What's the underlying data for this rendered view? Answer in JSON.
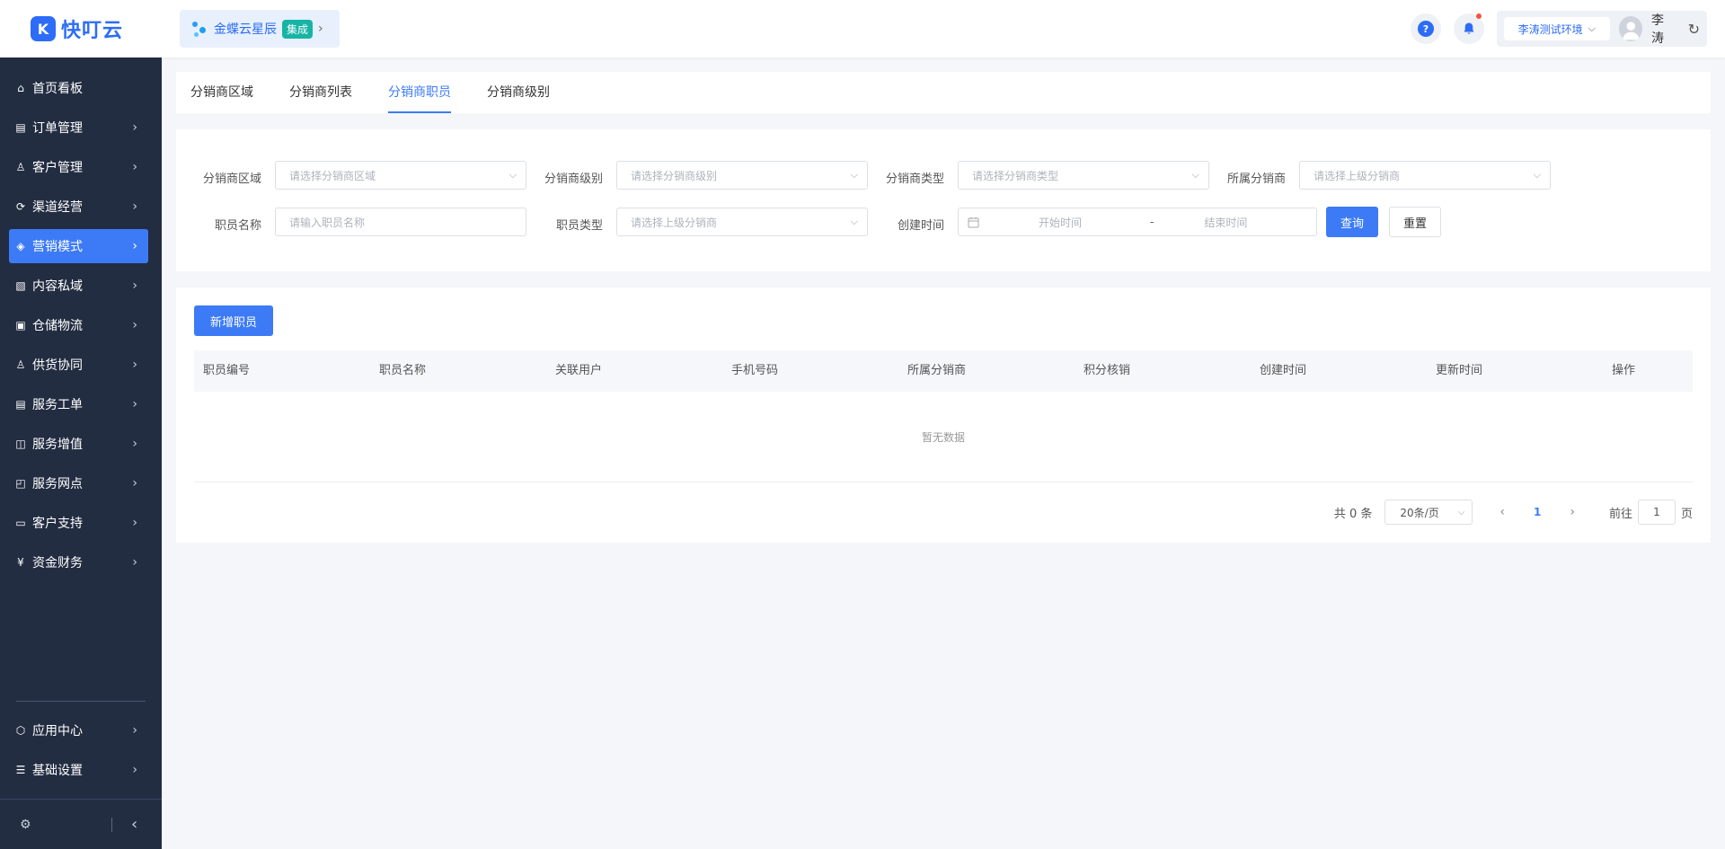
{
  "brand": {
    "logo_glyph": "K",
    "name": "快叮云"
  },
  "integration": {
    "name": "金蝶云星辰",
    "badge": "集成",
    "chevron": "›"
  },
  "header": {
    "help_glyph": "?",
    "env_label": "李涛测试环境",
    "user_name": "李涛",
    "refresh_glyph": "↻"
  },
  "sidebar": {
    "items": [
      {
        "label": "首页看板",
        "icon": "home-icon",
        "glyph": "⌂"
      },
      {
        "label": "订单管理",
        "icon": "clipboard-icon",
        "glyph": "▤"
      },
      {
        "label": "客户管理",
        "icon": "user-icon",
        "glyph": "♙"
      },
      {
        "label": "渠道经营",
        "icon": "channel-icon",
        "glyph": "⟳"
      },
      {
        "label": "营销模式",
        "icon": "tag-icon",
        "glyph": "◈"
      },
      {
        "label": "内容私域",
        "icon": "image-icon",
        "glyph": "▧"
      },
      {
        "label": "仓储物流",
        "icon": "box-icon",
        "glyph": "▣"
      },
      {
        "label": "供货协同",
        "icon": "supplier-icon",
        "glyph": "♙"
      },
      {
        "label": "服务工单",
        "icon": "ticket-icon",
        "glyph": "▤"
      },
      {
        "label": "服务增值",
        "icon": "bag-icon",
        "glyph": "◫"
      },
      {
        "label": "服务网点",
        "icon": "store-icon",
        "glyph": "◰"
      },
      {
        "label": "客户支持",
        "icon": "support-icon",
        "glyph": "▭"
      },
      {
        "label": "资金财务",
        "icon": "yen-icon",
        "glyph": "¥"
      }
    ],
    "bottom_items": [
      {
        "label": "应用中心",
        "icon": "cube-icon",
        "glyph": "⬡"
      },
      {
        "label": "基础设置",
        "icon": "settings-sliders-icon",
        "glyph": "☰"
      }
    ],
    "footer_settings_glyph": "⚙",
    "footer_collapse_glyph": "‹",
    "chevron": "›"
  },
  "tabs": [
    {
      "label": "分销商区域"
    },
    {
      "label": "分销商列表"
    },
    {
      "label": "分销商职员"
    },
    {
      "label": "分销商级别"
    }
  ],
  "filters": {
    "region_label": "分销商区域",
    "region_placeholder": "请选择分销商区域",
    "level_label": "分销商级别",
    "level_placeholder": "请选择分销商级别",
    "type_label": "分销商类型",
    "type_placeholder": "请选择分销商类型",
    "parent_label": "所属分销商",
    "parent_placeholder": "请选择上级分销商",
    "staff_name_label": "职员名称",
    "staff_name_placeholder": "请输入职员名称",
    "staff_type_label": "职员类型",
    "staff_type_placeholder": "请选择上级分销商",
    "created_label": "创建时间",
    "start_placeholder": "开始时间",
    "range_sep": "-",
    "end_placeholder": "结束时间",
    "query_button": "查询",
    "reset_button": "重置"
  },
  "table": {
    "add_button": "新增职员",
    "columns": [
      "职员编号",
      "职员名称",
      "关联用户",
      "手机号码",
      "所属分销商",
      "积分核销",
      "创建时间",
      "更新时间",
      "操作"
    ],
    "empty_text": "暂无数据"
  },
  "pagination": {
    "total_text": "共 0 条",
    "page_size": "20条/页",
    "prev": "‹",
    "current_page": "1",
    "next": "›",
    "goto_label": "前往",
    "goto_value": "1",
    "page_suffix": "页"
  },
  "colors": {
    "primary": "#3d7bf6",
    "sidebar_bg": "#232d42",
    "brand": "#2c6cf6",
    "badge": "#17b4a6"
  }
}
